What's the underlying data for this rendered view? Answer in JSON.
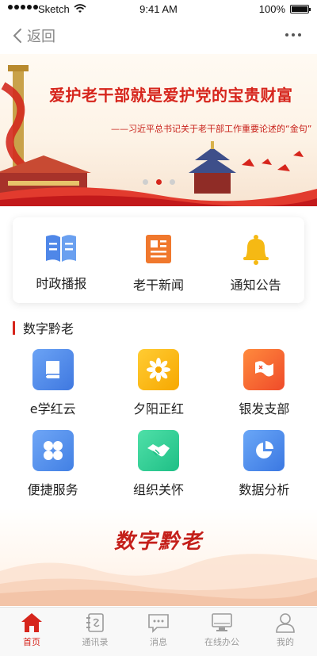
{
  "status_bar": {
    "carrier": "Sketch",
    "time": "9:41 AM",
    "battery": "100%"
  },
  "nav": {
    "back_label": "返回"
  },
  "banner": {
    "title": "爱护老干部就是爱护党的宝贵财富",
    "subtitle": "——习近平总书记关于老干部工作重要论述的“金句”",
    "pages": 3,
    "active_page": 2
  },
  "quick_links": [
    {
      "label": "时政播报",
      "icon": "book-icon",
      "color": "#4f87e8"
    },
    {
      "label": "老干新闻",
      "icon": "news-icon",
      "color": "#f0782d"
    },
    {
      "label": "通知公告",
      "icon": "bell-icon",
      "color": "#f5b914"
    }
  ],
  "section": {
    "title": "数字黔老"
  },
  "apps": [
    {
      "label": "e学红云",
      "icon": "book-icon",
      "color_a": "#6ba3f5",
      "color_b": "#3f78e0"
    },
    {
      "label": "夕阳正红",
      "icon": "flower-icon",
      "color_a": "#ffcc33",
      "color_b": "#f7a800"
    },
    {
      "label": "银发支部",
      "icon": "flag-icon",
      "color_a": "#ff8a3d",
      "color_b": "#ef4b2a"
    },
    {
      "label": "便捷服务",
      "icon": "grid-icon",
      "color_a": "#6fa6f6",
      "color_b": "#4280e4"
    },
    {
      "label": "组织关怀",
      "icon": "handshake-icon",
      "color_a": "#4fe0a8",
      "color_b": "#1fbf86"
    },
    {
      "label": "数据分析",
      "icon": "pie-chart-icon",
      "color_a": "#6aa7f7",
      "color_b": "#3b78e2"
    }
  ],
  "footer_logo": "数字黔老",
  "tabs": [
    {
      "label": "首页",
      "icon": "home-icon",
      "active": true
    },
    {
      "label": "通讯录",
      "icon": "contacts-icon",
      "active": false
    },
    {
      "label": "消息",
      "icon": "message-icon",
      "active": false
    },
    {
      "label": "在线办公",
      "icon": "monitor-icon",
      "active": false
    },
    {
      "label": "我的",
      "icon": "user-icon",
      "active": false
    }
  ],
  "colors": {
    "accent": "#d6251c",
    "tab_inactive": "#9b9b9b"
  }
}
